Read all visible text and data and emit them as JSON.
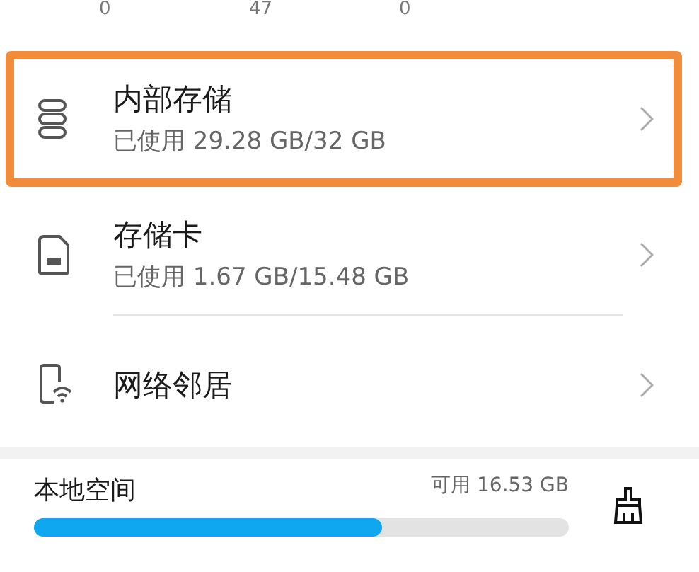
{
  "counts": [
    "0",
    "47",
    "0"
  ],
  "items": [
    {
      "kind": "internal",
      "title": "内部存储",
      "subtitle": "已使用 29.28 GB/32 GB",
      "highlighted": true
    },
    {
      "kind": "sdcard",
      "title": "存储卡",
      "subtitle": "已使用 1.67 GB/15.48 GB",
      "highlighted": false
    },
    {
      "kind": "network",
      "title": "网络邻居",
      "highlighted": false
    }
  ],
  "footer": {
    "label": "本地空间",
    "available": "可用 16.53 GB",
    "level": 0.65
  }
}
